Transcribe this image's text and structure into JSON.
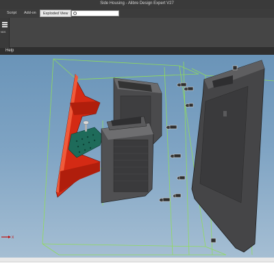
{
  "window": {
    "title": "Side Housing - Alibre Design Expert V27"
  },
  "menu": {
    "script": "Script",
    "addon": "Add-on",
    "exploded_view": "Exploded View"
  },
  "search": {
    "value": ""
  },
  "ribbon": {
    "group_label": "NDS"
  },
  "help": {
    "label": "Help"
  },
  "axis": {
    "x_label": "X"
  },
  "icons": {
    "ribbon_icon": "menu-lines-icon",
    "search_icon": "search-icon"
  },
  "colors": {
    "viewport_top": "#6a94b8",
    "viewport_bottom": "#a5bed3",
    "red_part": "#d42a14",
    "teal_part": "#1e6b5a",
    "gray_part": "#4a4a4c",
    "bounding_box": "#8fdc5a"
  }
}
